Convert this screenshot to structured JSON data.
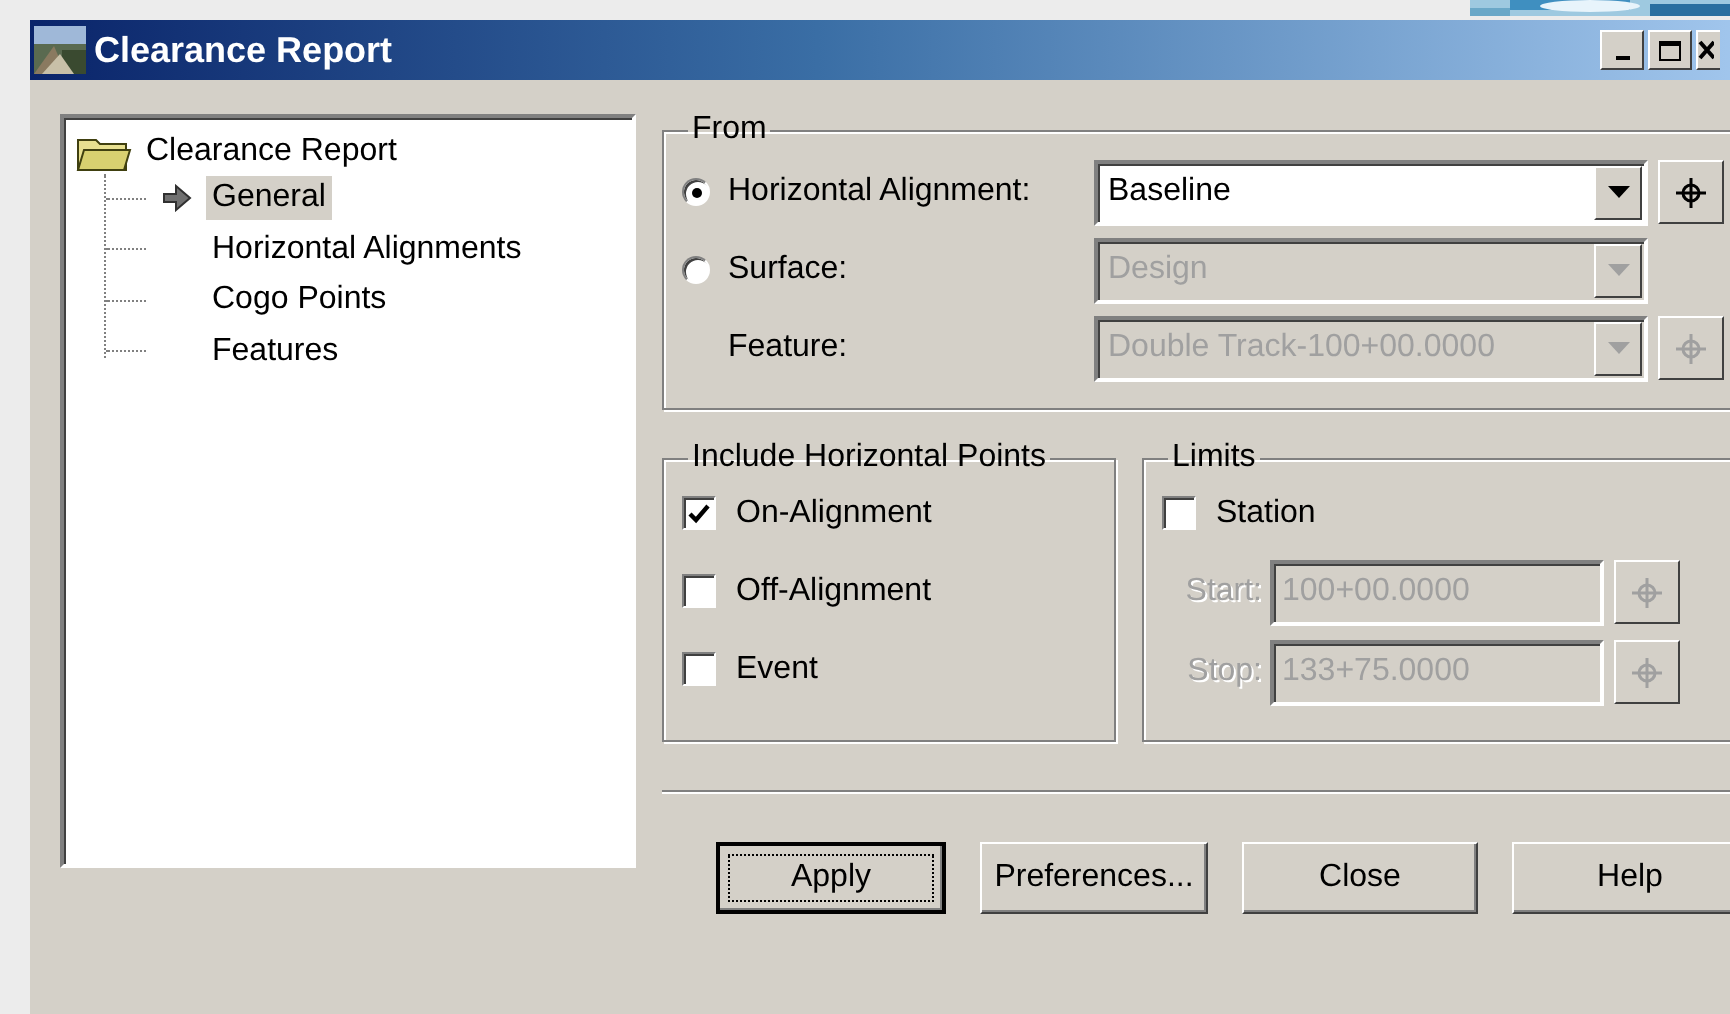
{
  "window": {
    "title": "Clearance Report"
  },
  "tree": {
    "label": "Clearance Report",
    "expanded": true,
    "children": [
      {
        "label": "General",
        "selected": true
      },
      {
        "label": "Horizontal Alignments",
        "selected": false
      },
      {
        "label": "Cogo Points",
        "selected": false
      },
      {
        "label": "Features",
        "selected": false
      }
    ]
  },
  "from": {
    "legend": "From",
    "rows": [
      {
        "kind": "radio",
        "label": "Horizontal Alignment:",
        "selected": true,
        "value": "Baseline",
        "disabled": false,
        "pick": true
      },
      {
        "kind": "radio",
        "label": "Surface:",
        "selected": false,
        "value": "Design",
        "disabled": true,
        "pick": false
      },
      {
        "kind": "plain",
        "label": "Feature:",
        "value": "Double Track-100+00.0000",
        "disabled": true,
        "pick": true
      }
    ]
  },
  "include": {
    "legend": "Include Horizontal Points",
    "items": [
      {
        "label": "On-Alignment",
        "checked": true
      },
      {
        "label": "Off-Alignment",
        "checked": false
      },
      {
        "label": "Event",
        "checked": false
      }
    ]
  },
  "limits": {
    "legend": "Limits",
    "station": {
      "label": "Station",
      "checked": false
    },
    "fields": [
      {
        "label": "Start:",
        "value": "100+00.0000",
        "disabled": true
      },
      {
        "label": "Stop:",
        "value": "133+75.0000",
        "disabled": true
      }
    ]
  },
  "buttons": [
    {
      "label": "Apply",
      "default": true
    },
    {
      "label": "Preferences...",
      "default": false
    },
    {
      "label": "Close",
      "default": false
    },
    {
      "label": "Help",
      "default": false
    }
  ]
}
